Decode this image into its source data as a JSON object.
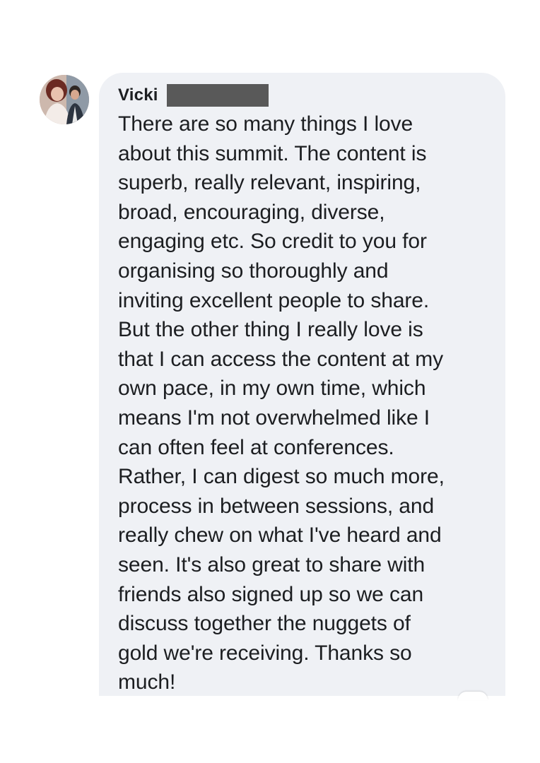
{
  "comment": {
    "author": "Vicki",
    "author_redacted": true,
    "text": "There are so many things I love\nabout this summit. The content is\nsuperb, really relevant, inspiring,\nbroad, encouraging, diverse,\nengaging etc. So credit to you for\norganising so thoroughly and\ninviting excellent people to share.\nBut the other thing I really love is\nthat I can access the content at my\nown pace, in my own time, which\nmeans I'm not overwhelmed like I\ncan often feel at conferences.\nRather, I can digest so much more,\nprocess in between sessions, and\nreally chew on what I've heard and\nseen. It's also great to share with\nfriends also signed up so we can\ndiscuss together the nuggets of\ngold we're receiving. Thanks so\nmuch!"
  },
  "colors": {
    "bubble": "#eff1f5",
    "text": "#1c1e21",
    "redaction": "#595959"
  }
}
